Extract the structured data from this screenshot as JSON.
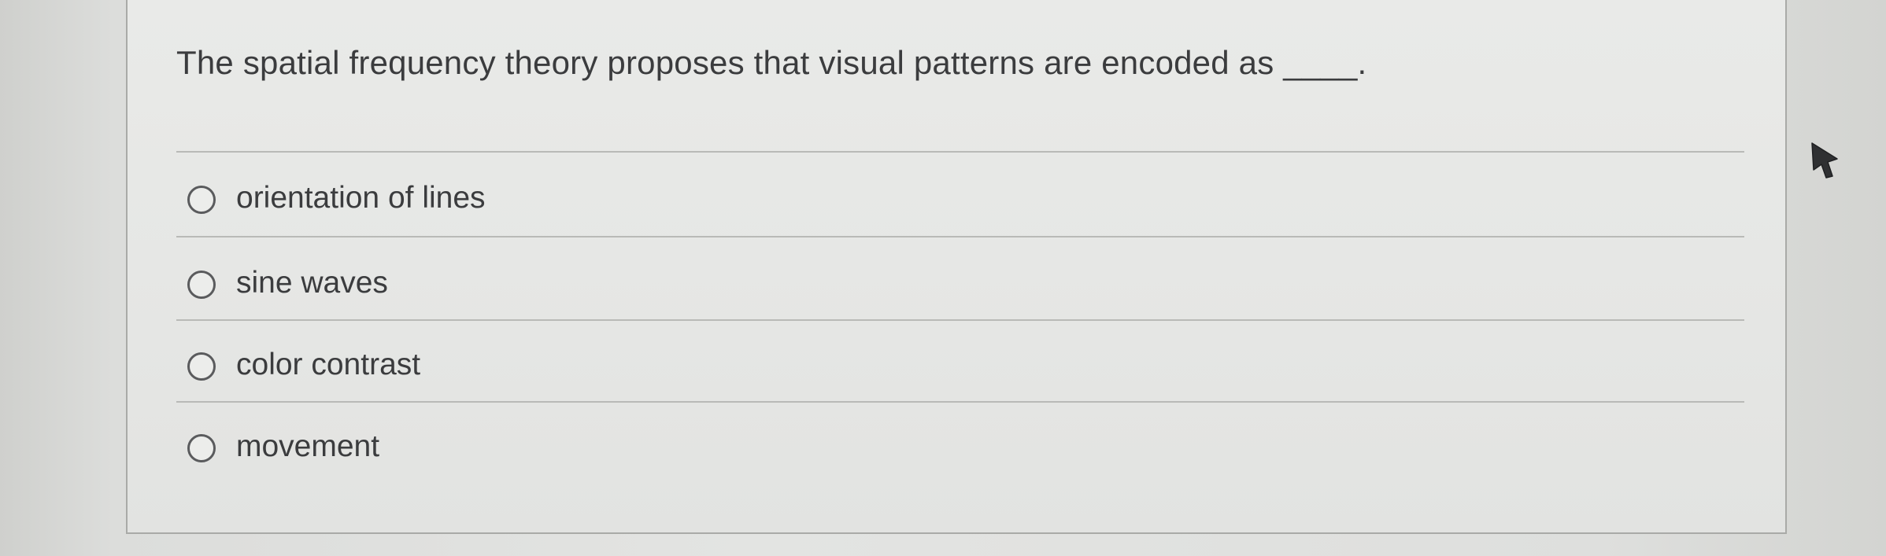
{
  "question": {
    "text": "The spatial frequency theory proposes that visual patterns are encoded as ____."
  },
  "options": [
    {
      "label": "orientation of lines",
      "selected": false
    },
    {
      "label": "sine waves",
      "selected": false
    },
    {
      "label": "color contrast",
      "selected": false
    },
    {
      "label": "movement",
      "selected": false
    }
  ],
  "cursor": {
    "icon": "mouse-pointer-icon"
  }
}
